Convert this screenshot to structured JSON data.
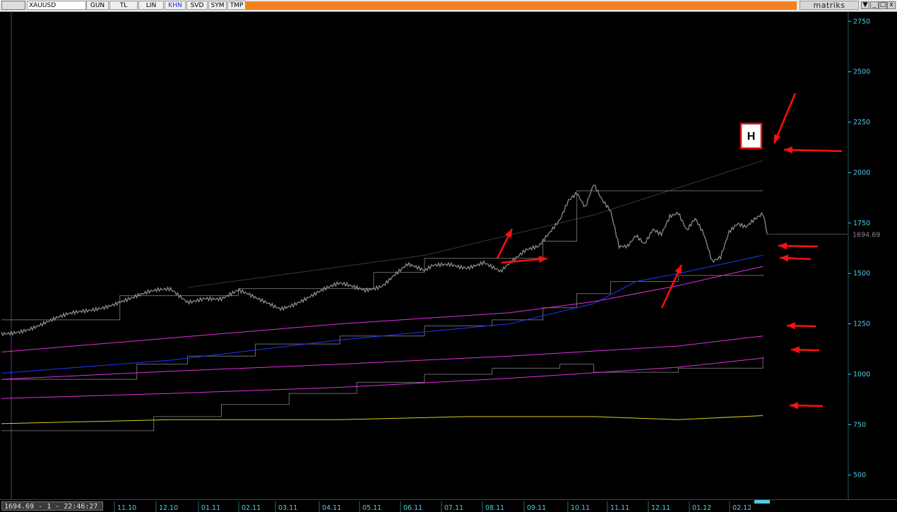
{
  "toolbar": {
    "symbol": "XAUUSD",
    "buttons": [
      "GUN",
      "TL",
      "LIN",
      "KHN",
      "SVD",
      "SYM",
      "TMP"
    ],
    "active_button": "KHN",
    "brand": "matriks",
    "window_buttons": [
      "▼",
      "_",
      "□",
      "x"
    ]
  },
  "status": {
    "readout": "1694.69 - 1 - 22:46:27"
  },
  "annotation": {
    "label": "H"
  },
  "colors": {
    "background": "#000000",
    "axis_text": "#4ad0e8",
    "price": "#8a8a8a",
    "blue_ma": "#2233ff",
    "magenta_ma": "#e030e0",
    "yellow_ma": "#d8d020",
    "channel": "#6a6a6a",
    "arrows": "#ff1010",
    "label_border": "#e01010"
  },
  "chart_data": {
    "type": "line",
    "y_axis": {
      "ticks": [
        500,
        750,
        1000,
        1250,
        1500,
        1750,
        2000,
        2250,
        2500,
        2750
      ],
      "ylim": [
        380,
        2800
      ],
      "position": "right"
    },
    "x_axis": {
      "labels": [
        "11.10",
        "12.10",
        "01.11",
        "02.11",
        "03.11",
        "04.11",
        "05.11",
        "06.11",
        "07.11",
        "08.11",
        "09.11",
        "10.11",
        "11.11",
        "12.11",
        "01.12",
        "02.12"
      ]
    },
    "last_value_label": "1694.69",
    "price": {
      "x": [
        0,
        6,
        10,
        14,
        17,
        20,
        22,
        24,
        26,
        28,
        30,
        33,
        36,
        38,
        40,
        43,
        45,
        46.5,
        48,
        50,
        51,
        53,
        55,
        57,
        59,
        61,
        62,
        63.5,
        64.5,
        66,
        67,
        68,
        69,
        70,
        71,
        72,
        73,
        74,
        75,
        76,
        77,
        78,
        79,
        80,
        81,
        82,
        83,
        84,
        85,
        86,
        87,
        88,
        89,
        90,
        90.5
      ],
      "y": [
        1200,
        1265,
        1310,
        1370,
        1395,
        1415,
        1365,
        1390,
        1375,
        1405,
        1370,
        1335,
        1380,
        1410,
        1440,
        1425,
        1450,
        1500,
        1540,
        1500,
        1530,
        1550,
        1540,
        1560,
        1500,
        1570,
        1610,
        1640,
        1700,
        1780,
        1870,
        1900,
        1820,
        1930,
        1850,
        1800,
        1630,
        1640,
        1700,
        1660,
        1730,
        1700,
        1780,
        1790,
        1700,
        1760,
        1690,
        1560,
        1590,
        1720,
        1760,
        1740,
        1770,
        1790,
        1694.69
      ]
    },
    "series": [
      {
        "x": [
          0,
          20,
          40,
          60,
          70,
          75,
          80,
          85,
          90
        ],
        "y": [
          1005,
          1070,
          1170,
          1250,
          1350,
          1460,
          1500,
          1545,
          1590
        ]
      },
      {
        "x": [
          0,
          20,
          40,
          60,
          70,
          80,
          90
        ],
        "y": [
          1110,
          1180,
          1250,
          1305,
          1360,
          1440,
          1535
        ]
      },
      {
        "x": [
          0,
          20,
          40,
          60,
          80,
          90
        ],
        "y": [
          975,
          1015,
          1050,
          1090,
          1140,
          1190
        ]
      },
      {
        "x": [
          0,
          20,
          40,
          60,
          80,
          90
        ],
        "y": [
          880,
          905,
          935,
          980,
          1035,
          1080
        ]
      },
      {
        "x": [
          0,
          20,
          40,
          55,
          70,
          80,
          90
        ],
        "y": [
          755,
          775,
          775,
          790,
          790,
          775,
          795
        ]
      }
    ],
    "upper_trendline": {
      "x": [
        22,
        50,
        70,
        90
      ],
      "y": [
        1430,
        1590,
        1790,
        2060
      ]
    },
    "x_range": [
      0,
      100
    ]
  }
}
